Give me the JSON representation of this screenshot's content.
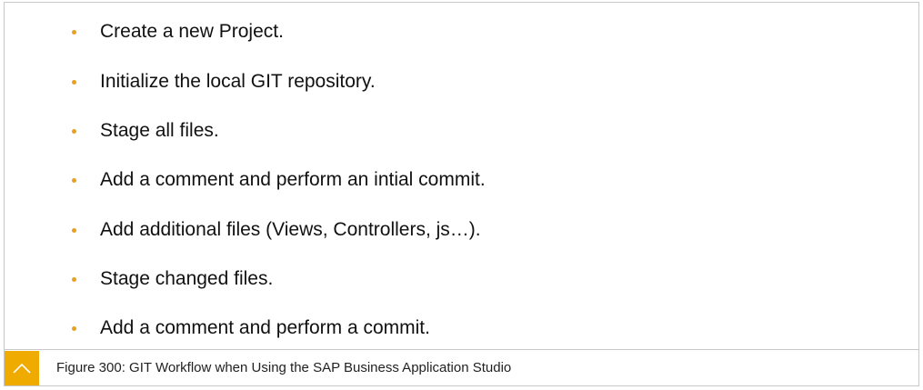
{
  "bullets": [
    {
      "text": "Create a new Project."
    },
    {
      "text": "Initialize the local GIT repository."
    },
    {
      "text": "Stage all files."
    },
    {
      "text": "Add a comment and perform an intial commit."
    },
    {
      "text": "Add additional files (Views, Controllers, js…)."
    },
    {
      "text": "Stage changed files."
    },
    {
      "text": "Add a comment and perform a commit."
    }
  ],
  "caption": {
    "icon": "chevron-up-icon",
    "text": "Figure 300: GIT Workflow when Using the SAP Business Application Studio"
  },
  "colors": {
    "bullet": "#e8a020",
    "caption_icon_bg": "#f0ab00"
  }
}
